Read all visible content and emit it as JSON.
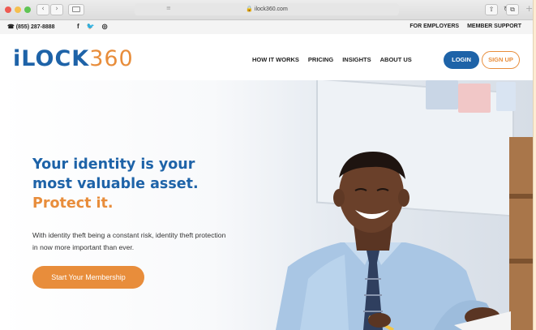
{
  "browser": {
    "address": "ilock360.com"
  },
  "topbar": {
    "phone": "(855) 287-8888",
    "social": [
      "f",
      "𝕪",
      "◎"
    ],
    "links": [
      "FOR EMPLOYERS",
      "MEMBER SUPPORT"
    ]
  },
  "header": {
    "logo_part1": "iLOCK",
    "logo_part2": "360",
    "nav": [
      "HOW IT WORKS",
      "PRICING",
      "INSIGHTS",
      "ABOUT US"
    ],
    "login_label": "LOGIN",
    "signup_label": "SIGN UP"
  },
  "hero": {
    "headline_line1": "Your identity is your",
    "headline_line2": "most valuable asset.",
    "headline_line3": "Protect it.",
    "subtext": "With identity theft being a constant risk, identity theft protection in now more important than ever.",
    "cta_label": "Start Your Membership"
  },
  "colors": {
    "brand_blue": "#1e63a8",
    "brand_orange": "#e88d3b",
    "page_bg": "#fdecd2"
  }
}
